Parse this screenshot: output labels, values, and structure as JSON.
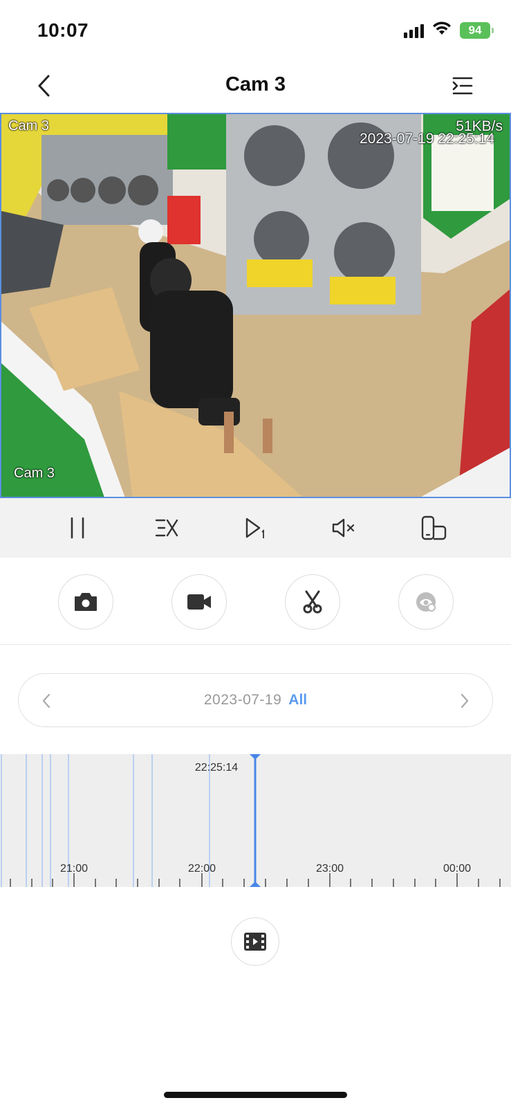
{
  "status_bar": {
    "time": "10:07",
    "battery": "94"
  },
  "header": {
    "title": "Cam 3",
    "back_icon": "chevron-left-icon",
    "menu_icon": "list-indent-icon"
  },
  "video": {
    "camera_label_top": "Cam 3",
    "bitrate": "51KB/s",
    "timestamp": "2023-07-19 22:25:14",
    "camera_label_bottom": "Cam 3",
    "border_color": "#5a8fe0"
  },
  "controls": [
    {
      "name": "pause-icon"
    },
    {
      "name": "speed-icon"
    },
    {
      "name": "frame-step-icon"
    },
    {
      "name": "mute-icon"
    },
    {
      "name": "orientation-icon"
    }
  ],
  "tools": [
    {
      "name": "snapshot-camera-icon",
      "enabled": true
    },
    {
      "name": "record-video-icon",
      "enabled": true
    },
    {
      "name": "clip-scissors-icon",
      "enabled": true
    },
    {
      "name": "privacy-eye-icon",
      "enabled": false
    }
  ],
  "date_selector": {
    "date": "2023-07-19",
    "filter": "All"
  },
  "timeline": {
    "cursor_time": "22:25:14",
    "hour_labels": [
      "21:00",
      "22:00",
      "23:00",
      "00:00"
    ],
    "accent_color": "#4a86e8"
  },
  "bottom": {
    "clips_icon": "film-icon"
  }
}
